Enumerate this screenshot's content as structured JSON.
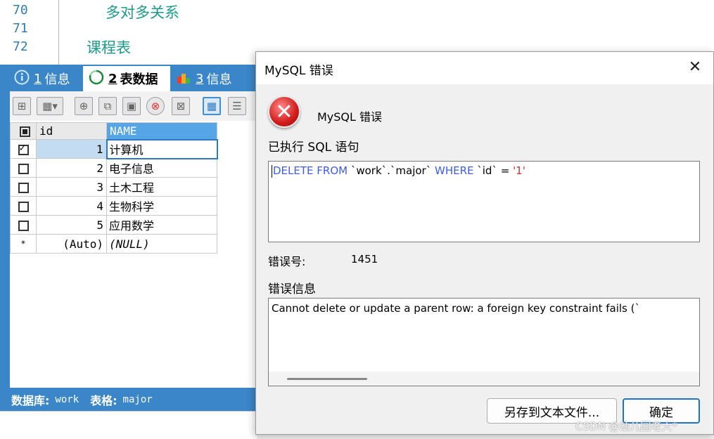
{
  "editor": {
    "lines": [
      {
        "num": "70",
        "text": "多对多关系"
      },
      {
        "num": "71",
        "text": ""
      },
      {
        "num": "72",
        "text": "课程表"
      }
    ]
  },
  "tabs": [
    {
      "num": "1",
      "label": "信息",
      "icon": "info-icon"
    },
    {
      "num": "2",
      "label": "表数据",
      "icon": "loading-icon"
    },
    {
      "num": "3",
      "label": "信息",
      "icon": "chart-icon"
    }
  ],
  "grid": {
    "headers": [
      "id",
      "NAME"
    ],
    "rows": [
      {
        "id": "1",
        "name": "计算机",
        "checked": true
      },
      {
        "id": "2",
        "name": "电子信息",
        "checked": false
      },
      {
        "id": "3",
        "name": "土木工程",
        "checked": false
      },
      {
        "id": "4",
        "name": "生物科学",
        "checked": false
      },
      {
        "id": "5",
        "name": "应用数学",
        "checked": false
      }
    ],
    "new_row": {
      "marker": "*",
      "id": "(Auto)",
      "name": "(NULL)"
    }
  },
  "statusbar": {
    "db_label": "数据库:",
    "db_value": "work",
    "table_label": "表格:",
    "table_value": "major"
  },
  "dialog": {
    "title": "MySQL 错误",
    "heading": "MySQL 错误",
    "sql_label": "已执行 SQL 语句",
    "sql": {
      "kw1": "DELETE FROM",
      "table": " `work`.`major` ",
      "kw2": "WHERE",
      "col": " `id` = ",
      "val": "'1'"
    },
    "errno_label": "错误号:",
    "errno": "1451",
    "errinfo_label": "错误信息",
    "errinfo": "Cannot delete or update a parent row: a foreign key constraint fails (`",
    "save_button": "另存到文本文件...",
    "ok_button": "确定",
    "close_glyph": "✕"
  },
  "watermark": "CSDN @幼儿园老大*"
}
